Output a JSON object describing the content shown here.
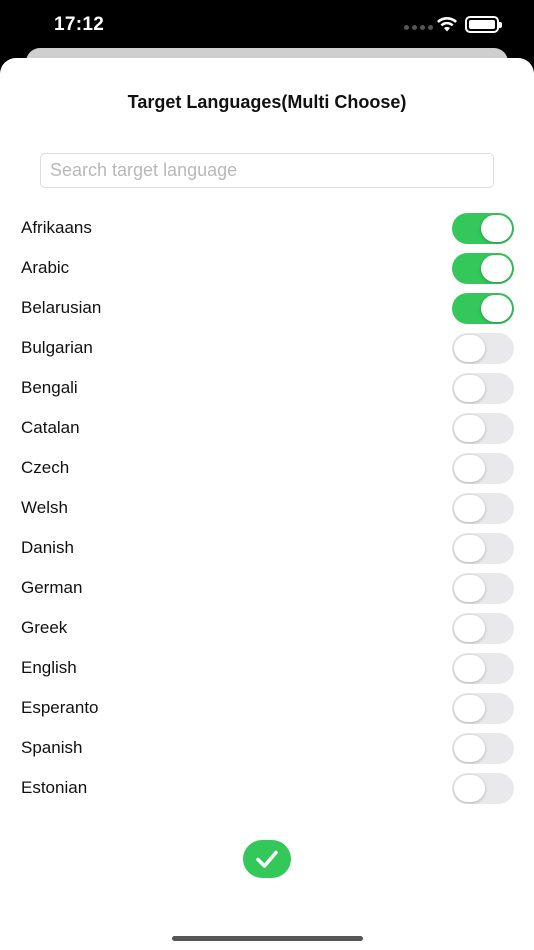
{
  "status_bar": {
    "time": "17:12"
  },
  "sheet": {
    "title": "Target Languages(Multi Choose)",
    "search": {
      "placeholder": "Search target language",
      "value": ""
    }
  },
  "languages": [
    {
      "name": "Afrikaans",
      "selected": true
    },
    {
      "name": "Arabic",
      "selected": true
    },
    {
      "name": "Belarusian",
      "selected": true
    },
    {
      "name": "Bulgarian",
      "selected": false
    },
    {
      "name": "Bengali",
      "selected": false
    },
    {
      "name": "Catalan",
      "selected": false
    },
    {
      "name": "Czech",
      "selected": false
    },
    {
      "name": "Welsh",
      "selected": false
    },
    {
      "name": "Danish",
      "selected": false
    },
    {
      "name": "German",
      "selected": false
    },
    {
      "name": "Greek",
      "selected": false
    },
    {
      "name": "English",
      "selected": false
    },
    {
      "name": "Esperanto",
      "selected": false
    },
    {
      "name": "Spanish",
      "selected": false
    },
    {
      "name": "Estonian",
      "selected": false
    }
  ],
  "icons": {
    "confirm": "checkmark-icon",
    "wifi": "wifi-icon",
    "battery": "battery-icon"
  },
  "colors": {
    "accent": "#34c759",
    "toggle_off": "#e9e9eb"
  }
}
